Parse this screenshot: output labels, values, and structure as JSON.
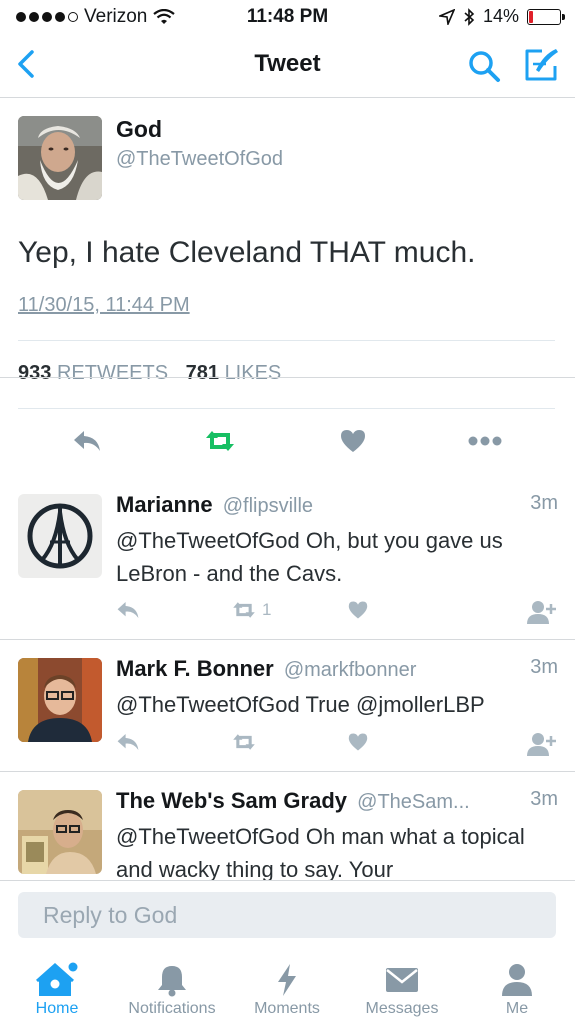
{
  "status_bar": {
    "carrier": "Verizon",
    "time": "11:48 PM",
    "battery_percent": "14%",
    "battery_level": 0.14,
    "battery_color": "#e0202a",
    "icons": [
      "signal-dots-icon",
      "wifi-icon",
      "location-arrow-icon",
      "bluetooth-icon",
      "battery-icon"
    ]
  },
  "nav": {
    "title": "Tweet",
    "back_icon": "chevron-left-icon",
    "search_icon": "search-icon",
    "compose_icon": "compose-tweet-icon",
    "accent": "#1da1f2"
  },
  "tweet": {
    "name": "God",
    "handle": "@TheTweetOfGod",
    "text": "Yep, I hate Cleveland THAT much.",
    "timestamp": "11/30/15, 11:44 PM",
    "retweets_count": "933",
    "retweets_label": "RETWEETS",
    "likes_count": "781",
    "likes_label": "LIKES",
    "actions": [
      "reply-icon",
      "retweet-icon",
      "heart-icon",
      "more-icon"
    ],
    "retweet_color": "#17bf63"
  },
  "replies": [
    {
      "name": "Marianne",
      "handle": "@flipsville",
      "time": "3m",
      "text": "@TheTweetOfGod Oh, but you gave us LeBron - and the Cavs.",
      "retweet_count": "1"
    },
    {
      "name": "Mark F. Bonner",
      "handle": "@markfbonner",
      "time": "3m",
      "text": "@TheTweetOfGod True @jmollerLBP",
      "retweet_count": ""
    },
    {
      "name": "The Web's Sam Grady",
      "handle": "@TheSam...",
      "time": "3m",
      "text": "@TheTweetOfGod Oh man what a topical and wacky thing to say. Your",
      "retweet_count": ""
    }
  ],
  "reply_box": {
    "placeholder": "Reply to God"
  },
  "tabs": [
    {
      "label": "Home",
      "icon": "home-icon",
      "active": true
    },
    {
      "label": "Notifications",
      "icon": "bell-icon",
      "active": false
    },
    {
      "label": "Moments",
      "icon": "lightning-icon",
      "active": false
    },
    {
      "label": "Messages",
      "icon": "envelope-icon",
      "active": false
    },
    {
      "label": "Me",
      "icon": "person-icon",
      "active": false
    }
  ]
}
